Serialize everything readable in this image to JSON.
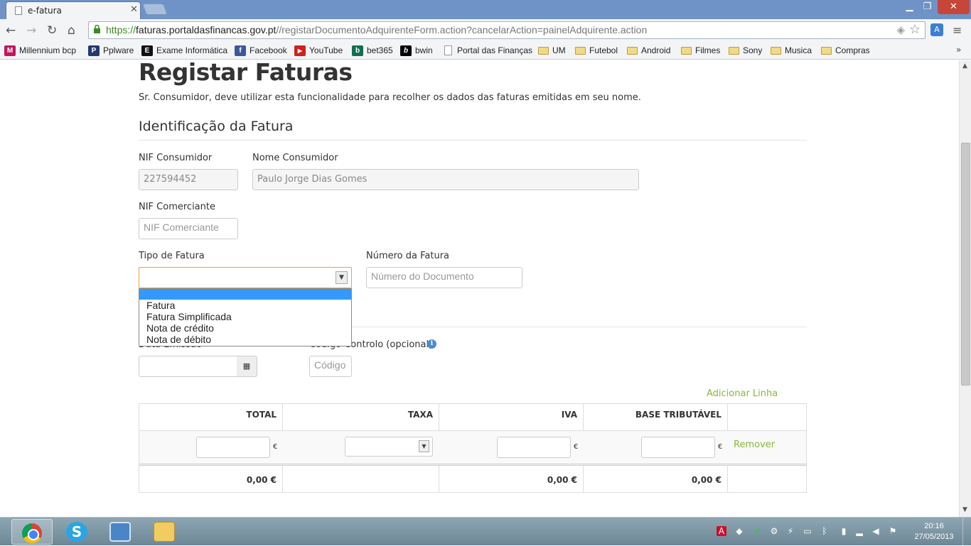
{
  "browser": {
    "tab_title": "e-fatura",
    "url_https": "https://",
    "url_host": "faturas.portaldasfinancas.gov.pt",
    "url_path": "//registarDocumentoAdquirenteForm.action?cancelarAction=painelAdquirente.action",
    "bookmarks": [
      {
        "label": "Millennium bcp",
        "icon": "M"
      },
      {
        "label": "Pplware",
        "icon": "P"
      },
      {
        "label": "Exame Informática",
        "icon": "E"
      },
      {
        "label": "Facebook",
        "icon": "f"
      },
      {
        "label": "YouTube",
        "icon": "▶"
      },
      {
        "label": "bet365",
        "icon": "b"
      },
      {
        "label": "bwin",
        "icon": "b"
      },
      {
        "label": "Portal das Finanças",
        "icon": "page"
      },
      {
        "label": "UM",
        "icon": "folder"
      },
      {
        "label": "Futebol",
        "icon": "folder"
      },
      {
        "label": "Android",
        "icon": "folder"
      },
      {
        "label": "Filmes",
        "icon": "folder"
      },
      {
        "label": "Sony",
        "icon": "folder"
      },
      {
        "label": "Musica",
        "icon": "folder"
      },
      {
        "label": "Compras",
        "icon": "folder"
      }
    ]
  },
  "page": {
    "title": "Registar Faturas",
    "description": "Sr. Consumidor, deve utilizar esta funcionalidade para recolher os dados das faturas emitidas em seu nome.",
    "section_title": "Identificação da Fatura",
    "nif_consumidor_label": "NIF Consumidor",
    "nif_consumidor_value": "227594452",
    "nome_consumidor_label": "Nome Consumidor",
    "nome_consumidor_value": "Paulo Jorge Dias Gomes",
    "nif_comerciante_label": "NIF Comerciante",
    "nif_comerciante_placeholder": "NIF Comerciante",
    "tipo_fatura_label": "Tipo de Fatura",
    "tipo_fatura_options": [
      "",
      "Fatura",
      "Fatura Simplificada",
      "Nota de crédito",
      "Nota de débito"
    ],
    "numero_fatura_label": "Número da Fatura",
    "numero_fatura_placeholder": "Número do Documento",
    "data_emissao_label": "Data Emissão",
    "codigo_controlo_label": "Código Controlo (opcional)",
    "codigo_placeholder": "Código",
    "adicionar_linha": "Adicionar Linha",
    "table": {
      "headers": [
        "TOTAL",
        "TAXA",
        "IVA",
        "BASE TRIBUTÁVEL"
      ],
      "currency": "€",
      "remover": "Remover",
      "totals": {
        "total": "0,00 €",
        "iva": "0,00 €",
        "base": "0,00 €"
      }
    }
  },
  "taskbar": {
    "time": "20:16",
    "date": "27/05/2013"
  }
}
